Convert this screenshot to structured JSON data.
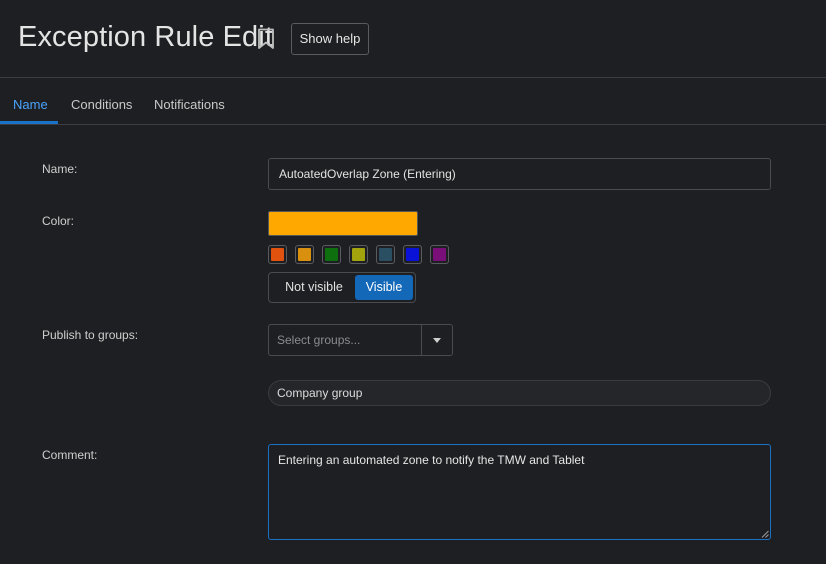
{
  "header": {
    "title": "Exception Rule Edit",
    "help_label": "Show help"
  },
  "tabs": [
    {
      "label": "Name",
      "active": true
    },
    {
      "label": "Conditions",
      "active": false
    },
    {
      "label": "Notifications",
      "active": false
    }
  ],
  "form": {
    "name_label": "Name:",
    "name_value": "AutoatedOverlap Zone (Entering)",
    "color_label": "Color:",
    "selected_color": "#ffa800",
    "swatches": [
      "#e0520e",
      "#d9900e",
      "#0e6f0e",
      "#a3a30e",
      "#2b4f62",
      "#0a12d8",
      "#7a0f7a"
    ],
    "visibility": {
      "off_label": "Not visible",
      "on_label": "Visible",
      "selected": "Visible"
    },
    "publish_label": "Publish to groups:",
    "groups_placeholder": "Select groups...",
    "group_tag": "Company group",
    "comment_label": "Comment:",
    "comment_value": "Entering an automated zone to notify the TMW and Tablet"
  },
  "colors": {
    "background": "#1e1f22",
    "accent": "#1468b8",
    "active_tab": "#4aa3ff"
  }
}
